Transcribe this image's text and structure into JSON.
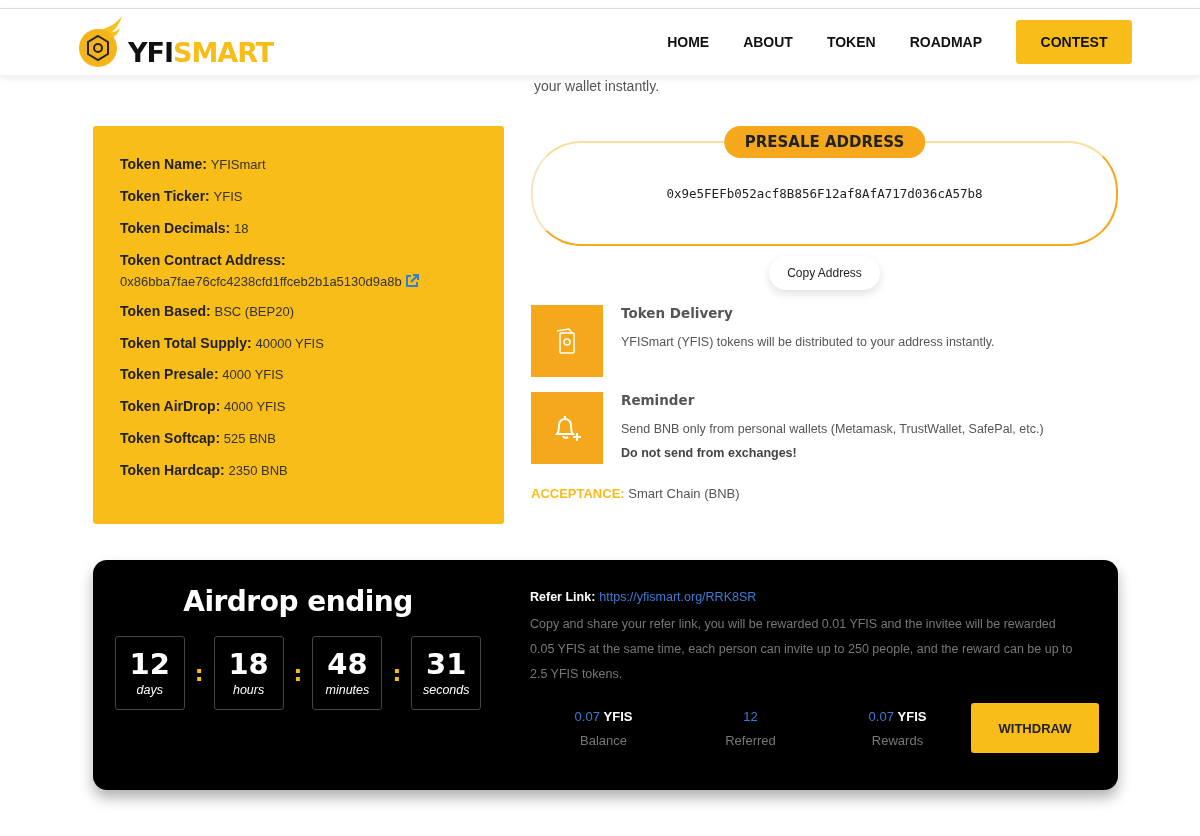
{
  "header": {
    "logo": {
      "part_1": "YFI",
      "part_2": "SMART"
    },
    "nav": [
      {
        "label": "HOME",
        "kind": "link"
      },
      {
        "label": "ABOUT",
        "kind": "link"
      },
      {
        "label": "TOKEN",
        "kind": "link"
      },
      {
        "label": "ROADMAP",
        "kind": "link"
      },
      {
        "label": "CONTEST",
        "kind": "button"
      }
    ]
  },
  "partial_text": "your wallet instantly.",
  "token_info": [
    {
      "label": "Token Name:",
      "value": "YFISmart"
    },
    {
      "label": "Token Ticker:",
      "value": "YFIS"
    },
    {
      "label": "Token Decimals:",
      "value": "18"
    },
    {
      "label": "Token Contract Address:",
      "value": "0x86bba7fae76cfc4238cfd1ffceb2b1a5130d9a8b",
      "kind": "address"
    },
    {
      "label": "Token Based:",
      "value": "BSC (BEP20)"
    },
    {
      "label": "Token Total Supply:",
      "value": "40000 YFIS"
    },
    {
      "label": "Token Presale:",
      "value": "4000 YFIS"
    },
    {
      "label": "Token AirDrop:",
      "value": "4000 YFIS"
    },
    {
      "label": "Token Softcap:",
      "value": "525 BNB"
    },
    {
      "label": "Token Hardcap:",
      "value": "2350 BNB"
    }
  ],
  "presale": {
    "title": "PRESALE ADDRESS",
    "address": "0x9e5FEFb052acf8B856F12af8AfA717d036cA57b8",
    "copy_button": "Copy Address"
  },
  "features": [
    {
      "kind": "money",
      "title": "Token Delivery",
      "text": "YFISmart (YFIS) tokens will be distributed to your address instantly."
    },
    {
      "kind": "bell",
      "title": "Reminder",
      "text": "Send BNB only from personal wallets (Metamask, TrustWallet, SafePal, etc.)",
      "warning": "Do not send from exchanges!"
    }
  ],
  "acceptance": {
    "label": "ACCEPTANCE:",
    "value": "Smart Chain (BNB)"
  },
  "airdrop": {
    "title": "Airdrop ending",
    "countdown": [
      {
        "value": "12",
        "unit": "days"
      },
      {
        "value": "18",
        "unit": "hours"
      },
      {
        "value": "48",
        "unit": "minutes"
      },
      {
        "value": "31",
        "unit": "seconds"
      }
    ],
    "separators": [
      ":",
      ":",
      ":"
    ]
  },
  "refer": {
    "label": "Refer Link:",
    "link": "https://yfismart.org/RRK8SR",
    "description": "Copy and share your refer link, you will be rewarded 0.01 YFIS and the invitee will be rewarded 0.05 YFIS at the same time, each person can invite up to 250 people, and the reward can be up to 2.5 YFIS tokens.",
    "stats": [
      {
        "value": "0.07",
        "unit": "YFIS",
        "label": "Balance"
      },
      {
        "value": "12",
        "label": "Referred"
      },
      {
        "value": "0.07",
        "unit": "YFIS",
        "label": "Rewards"
      }
    ],
    "withdraw_button": "WITHDRAW"
  }
}
